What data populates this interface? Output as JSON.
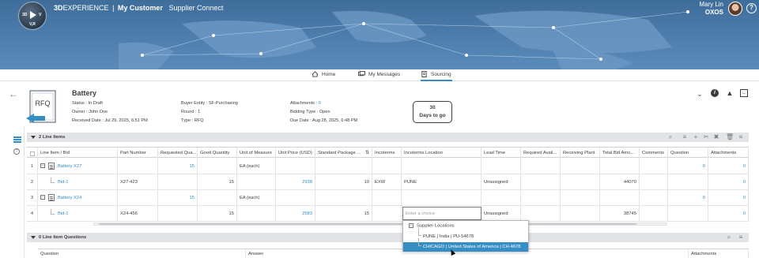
{
  "app": {
    "brand_prefix": "3D",
    "brand_suffix": "EXPERIENCE",
    "separator": "|",
    "tenant": "My Customer",
    "app_name": "Supplier Connect",
    "compass_labels": {
      "left": "3D",
      "right": "V",
      "bottom": "V,R"
    }
  },
  "user": {
    "name": "Mary Lin",
    "org": "OXOS"
  },
  "tabs": [
    {
      "label": "Home",
      "icon": "home-icon",
      "active": false
    },
    {
      "label": "My Messages",
      "icon": "messages-icon",
      "active": false
    },
    {
      "label": "Sourcing",
      "icon": "document-icon",
      "active": true
    }
  ],
  "header": {
    "rfq_icon_label": "RFQ",
    "title": "Battery",
    "col1": [
      {
        "k": "Status : ",
        "v": "In Draft"
      },
      {
        "k": "Owner : ",
        "v": "John Doe"
      },
      {
        "k": "Received Date : ",
        "v": "Jul 29, 2025, 6:51 PM"
      }
    ],
    "col2": [
      {
        "k": "Buyer Entity : ",
        "v": "SF-Purchasing"
      },
      {
        "k": "Round : ",
        "v": "1"
      },
      {
        "k": "Type : ",
        "v": "RFQ"
      }
    ],
    "col3": [
      {
        "k": "Attachments : ",
        "v": "0"
      },
      {
        "k": "Bidding Type : ",
        "v": "Open"
      },
      {
        "k": "Due Date : ",
        "v": "Aug 28, 2025, 6:48 PM"
      }
    ],
    "days_count": "30",
    "days_label": "Days to go"
  },
  "line_items": {
    "section_label": "2 Line Items",
    "columns": [
      "Line Item / Bid",
      "Part Number",
      "Requested Qua...",
      "Good Quantity",
      "Unit of Measure",
      "Unit Price (USD)",
      "Standard Package ...",
      "Incoterms",
      "Incoterms Location",
      "Lead Time",
      "Required Avail...",
      "Receiving Plant",
      "Total Bid Amo...",
      "Comments",
      "Question",
      "Attachments"
    ],
    "rows": [
      {
        "idx": "1",
        "name": "Battery X27",
        "part": "",
        "req": "15",
        "good": "",
        "uom": "EA (each)",
        "price": "",
        "pkg": "",
        "inc": "",
        "loc": "",
        "lead": "",
        "req_av": "",
        "plant": "",
        "total": "",
        "comments": "",
        "question": "0",
        "attach": "0"
      },
      {
        "idx": "2",
        "name": "Bid-1",
        "part": "X27-423",
        "req": "",
        "good": "15",
        "uom": "",
        "price": "2938",
        "pkg": "10",
        "inc": "EXW",
        "loc": "PUNE",
        "lead": "Unassigned",
        "req_av": "",
        "plant": "",
        "total": "44070",
        "comments": "",
        "question": "",
        "attach": "0"
      },
      {
        "idx": "3",
        "name": "Battery X24",
        "part": "",
        "req": "15",
        "good": "",
        "uom": "EA (each)",
        "price": "",
        "pkg": "",
        "inc": "",
        "loc": "",
        "lead": "",
        "req_av": "",
        "plant": "",
        "total": "",
        "comments": "",
        "question": "0",
        "attach": "0"
      },
      {
        "idx": "4",
        "name": "Bid-1",
        "part": "X24-456",
        "req": "",
        "good": "15",
        "uom": "",
        "price": "2583",
        "pkg": "15",
        "inc": "",
        "loc": "",
        "lead": "Unassigned",
        "req_av": "",
        "plant": "",
        "total": "38745",
        "comments": "",
        "question": "",
        "attach": "0"
      }
    ]
  },
  "incoterms_dropdown": {
    "placeholder": "Enter a choice",
    "group_label": "Supplier Locations",
    "options": [
      {
        "label": "PUNE | India | PU-54678",
        "selected": false
      },
      {
        "label": "CHICAGO | United States of America | CH-4678",
        "selected": true
      }
    ]
  },
  "questions": {
    "section_label": "0 Line Item Questions",
    "columns": [
      "Question",
      "Answer",
      "Attachments"
    ]
  },
  "colors": {
    "accent": "#368ec4",
    "banner": "#4b7bab",
    "section_bg": "#e2e4e7"
  }
}
